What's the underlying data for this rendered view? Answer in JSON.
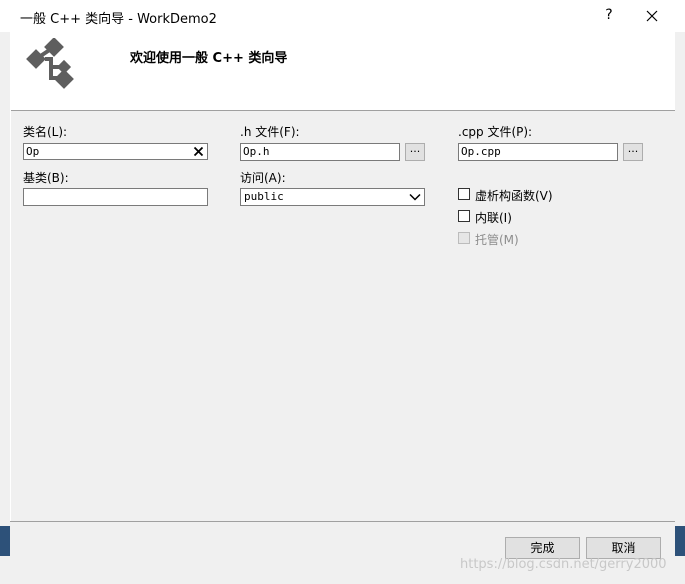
{
  "window": {
    "title": "一般 C++ 类向导 - WorkDemo2",
    "help_label": "?",
    "close_icon": "close-icon"
  },
  "header": {
    "title": "欢迎使用一般  C++  类向导",
    "logo_icon": "class-hierarchy-icon"
  },
  "form": {
    "class_name": {
      "label": "类名(L):",
      "value": "Op"
    },
    "h_file": {
      "label": ".h 文件(F):",
      "value": "Op.h",
      "browse_label": "..."
    },
    "cpp_file": {
      "label": ".cpp 文件(P):",
      "value": "Op.cpp",
      "browse_label": "..."
    },
    "base_class": {
      "label": "基类(B):",
      "value": ""
    },
    "access": {
      "label": "访问(A):",
      "value": "public"
    },
    "virtual_destructor": {
      "label": "虚析构函数(V)",
      "checked": false
    },
    "inline": {
      "label": "内联(I)",
      "checked": false
    },
    "managed": {
      "label": "托管(M)",
      "checked": false,
      "disabled": true
    }
  },
  "footer": {
    "finish_label": "完成",
    "cancel_label": "取消"
  },
  "watermark": "https://blog.csdn.net/gerry2000"
}
